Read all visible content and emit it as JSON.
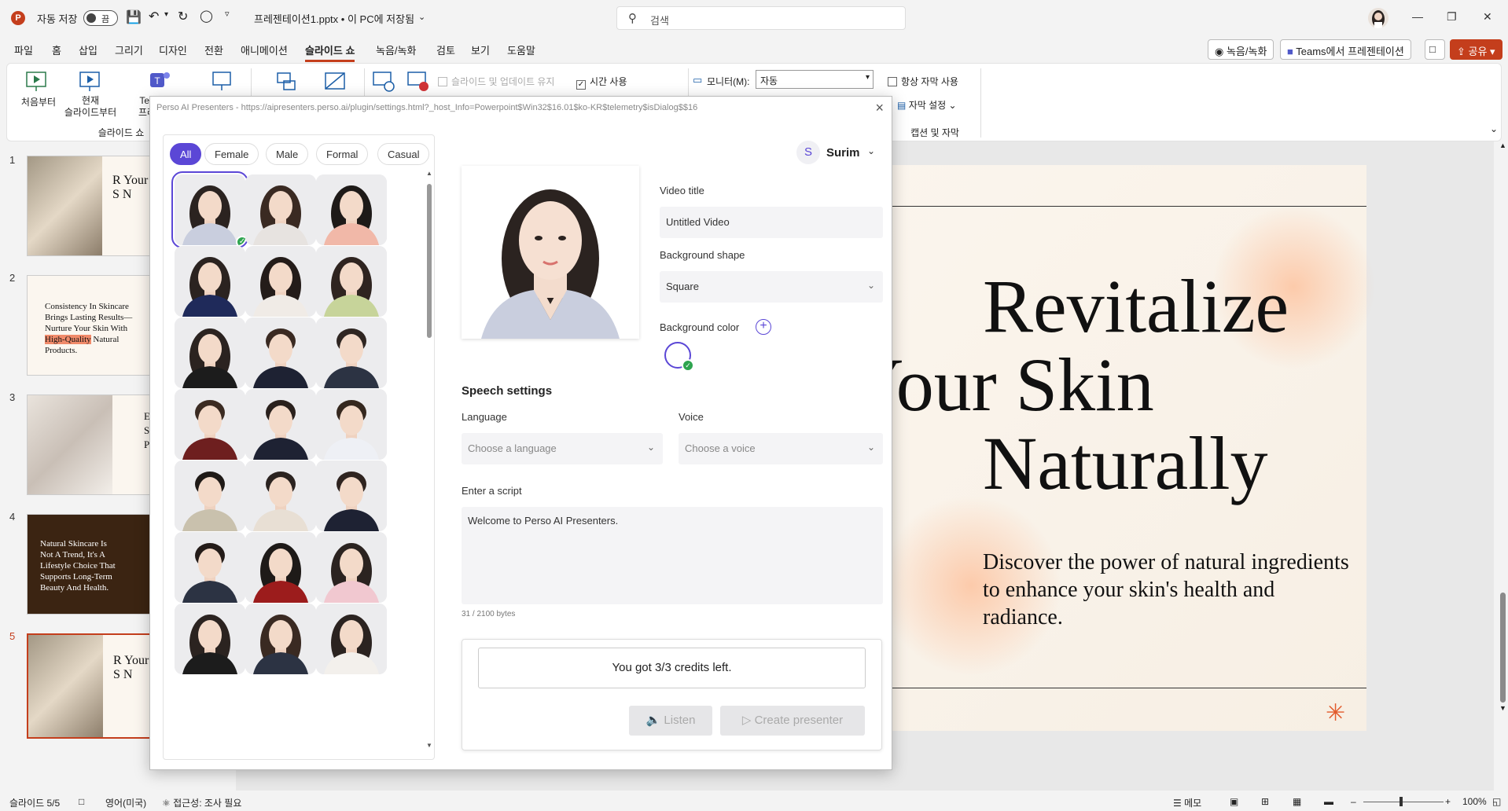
{
  "titlebar": {
    "autosave_label": "자동 저장",
    "autosave_state": "끔",
    "filename": "프레젠테이션1.pptx • 이 PC에 저장됨",
    "search_placeholder": "검색"
  },
  "menu": {
    "items": [
      "파일",
      "홈",
      "삽입",
      "그리기",
      "디자인",
      "전환",
      "애니메이션",
      "슬라이드 쇼",
      "녹음/녹화",
      "검토",
      "보기",
      "도움말"
    ],
    "active": "슬라이드 쇼",
    "record_button": "녹음/녹화",
    "teams_button": "Teams에서 프레젠테이션",
    "share_button": "공유"
  },
  "ribbon": {
    "from_beginning": "처음부터",
    "from_current_line1": "현재",
    "from_current_line2": "슬라이드부터",
    "teams_partial_line1": "Tea",
    "teams_partial_line2": "프레",
    "group_slideshow": "슬라이드 쇼",
    "keep_updated": "슬라이드 및 업데이트 유지",
    "use_timings": "시간 사용",
    "monitor_label": "모니터(M):",
    "monitor_value": "자동",
    "always_subtitles": "항상 자막 사용",
    "subtitle_settings": "자막 설정",
    "group_captions": "캡션 및 자막"
  },
  "thumbnails": [
    {
      "num": "1",
      "text": "R Your S N"
    },
    {
      "num": "2",
      "text_line1": "Consistency In Skincare",
      "text_line2": "Brings Lasting Results—",
      "text_line3": "Nurture Your Skin With",
      "highlight": "High-Quality",
      "text_line4_rest": "Natural",
      "text_line5": "Products."
    },
    {
      "num": "3",
      "text": "E S P"
    },
    {
      "num": "4",
      "text_line1": "Natural Skincare Is",
      "text_line2": "Not A Trend, It's A",
      "text_line3": "Lifestyle Choice That",
      "text_line4": "Supports Long-Term",
      "text_line5": "Beauty And Health."
    },
    {
      "num": "5",
      "text": "R Your S N"
    }
  ],
  "slide": {
    "title_line1": "Revitalize",
    "title_line2": "Your Skin",
    "title_line3": "Naturally",
    "body": "Discover the power of natural ingredients to enhance your skin's health and radiance."
  },
  "dialog": {
    "title": "Perso AI Presenters - https://aipresenters.perso.ai/plugin/settings.html?_host_Info=Powerpoint$Win32$16.01$ko-KR$telemetry$isDialog$$16",
    "filters": [
      "All",
      "Female",
      "Male",
      "Formal",
      "Casual"
    ],
    "user_initial": "S",
    "user_name": "Surim",
    "video_title_label": "Video title",
    "video_title_value": "Untitled Video",
    "bg_shape_label": "Background shape",
    "bg_shape_value": "Square",
    "bg_color_label": "Background color",
    "speech_title": "Speech settings",
    "language_label": "Language",
    "language_placeholder": "Choose a language",
    "voice_label": "Voice",
    "voice_placeholder": "Choose a voice",
    "script_label": "Enter a script",
    "script_value": "Welcome to Perso AI Presenters.",
    "byte_count": "31 / 2100 bytes",
    "credits": "You got 3/3 credits left.",
    "listen": "Listen",
    "create": "Create presenter"
  },
  "status": {
    "slide_pos": "슬라이드 5/5",
    "language": "영어(미국)",
    "accessibility": "접근성: 조사 필요",
    "notes": "메모",
    "zoom": "100%"
  },
  "colors": {
    "accent": "#5b47d6",
    "brand": "#c43e1c",
    "check": "#2ea44f"
  }
}
